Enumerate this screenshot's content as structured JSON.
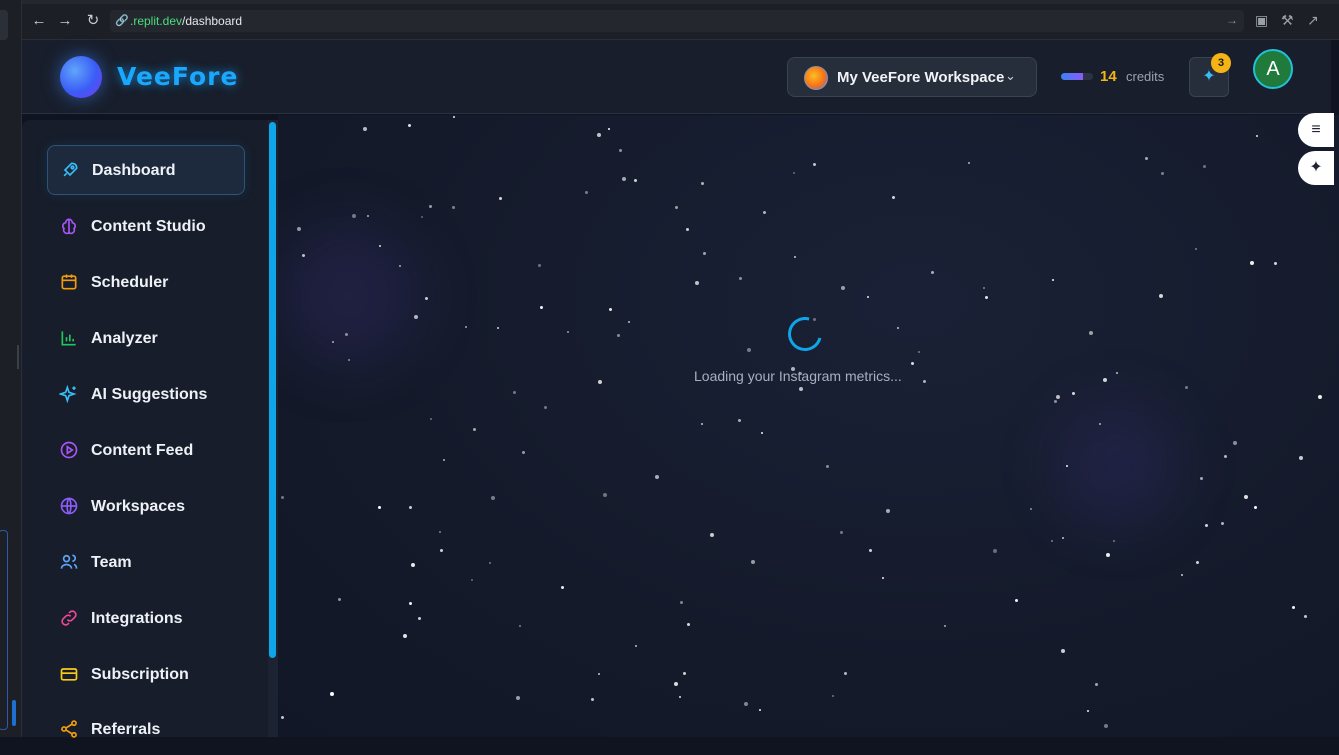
{
  "browser": {
    "url_domain": ".replit.dev",
    "url_path": "/dashboard"
  },
  "header": {
    "logo_text": "VeeFore",
    "workspace_label": "My VeeFore Workspace",
    "credits_value": "14",
    "credits_label": "credits",
    "credits_fill_fraction": 0.7,
    "notification_count": "3",
    "user_initial": "A"
  },
  "sidebar": {
    "items": [
      {
        "label": "Dashboard",
        "icon": "rocket-icon",
        "color": "#38bdf8"
      },
      {
        "label": "Content Studio",
        "icon": "brain-icon",
        "color": "#a855f7"
      },
      {
        "label": "Scheduler",
        "icon": "calendar-icon",
        "color": "#f59e0b"
      },
      {
        "label": "Analyzer",
        "icon": "bar-chart-icon",
        "color": "#22c55e"
      },
      {
        "label": "AI Suggestions",
        "icon": "sparkles-icon",
        "color": "#38bdf8"
      },
      {
        "label": "Content Feed",
        "icon": "play-circle-icon",
        "color": "#a855f7"
      },
      {
        "label": "Workspaces",
        "icon": "globe-icon",
        "color": "#8b5cf6"
      },
      {
        "label": "Team",
        "icon": "users-icon",
        "color": "#60a5fa"
      },
      {
        "label": "Integrations",
        "icon": "link-icon",
        "color": "#ec4899"
      },
      {
        "label": "Subscription",
        "icon": "credit-card-icon",
        "color": "#facc15"
      },
      {
        "label": "Referrals",
        "icon": "share-icon",
        "color": "#f59e0b"
      }
    ]
  },
  "main": {
    "loading_text": "Loading your Instagram metrics..."
  },
  "colors": {
    "accent": "#0ea5e9",
    "credits": "#f5b416",
    "background": "#111726"
  }
}
